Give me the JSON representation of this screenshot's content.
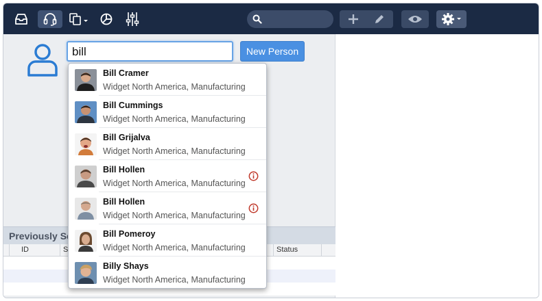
{
  "toolbar": {
    "icons": [
      "inbox-icon",
      "headset-icon",
      "copy-dropdown-icon",
      "pie-chart-icon",
      "sliders-icon",
      "search-icon",
      "plus-icon",
      "pencil-icon",
      "eye-icon",
      "gear-dropdown-icon"
    ],
    "search": {
      "value": "",
      "placeholder": ""
    }
  },
  "search_input": {
    "value": "bill"
  },
  "new_person_label": "New Person",
  "previously_section": {
    "title": "Previously Se"
  },
  "table": {
    "columns": [
      "ID",
      "S",
      "Status"
    ]
  },
  "results": [
    {
      "name": "Bill Cramer",
      "company": "Widget North America, Manufacturing",
      "warning": false
    },
    {
      "name": "Bill Cummings",
      "company": "Widget North America, Manufacturing",
      "warning": false
    },
    {
      "name": "Bill Grijalva",
      "company": "Widget North America, Manufacturing",
      "warning": false
    },
    {
      "name": "Bill Hollen",
      "company": "Widget North America, Manufacturing",
      "warning": true
    },
    {
      "name": "Bill Hollen",
      "company": "Widget North America, Manufacturing",
      "warning": true
    },
    {
      "name": "Bill Pomeroy",
      "company": "Widget North America, Manufacturing",
      "warning": false
    },
    {
      "name": "Billy Shays",
      "company": "Widget North America, Manufacturing",
      "warning": false
    }
  ],
  "colors": {
    "toolbar": "#1b2a44",
    "accent": "#4a90e2",
    "warning": "#c0392b"
  }
}
